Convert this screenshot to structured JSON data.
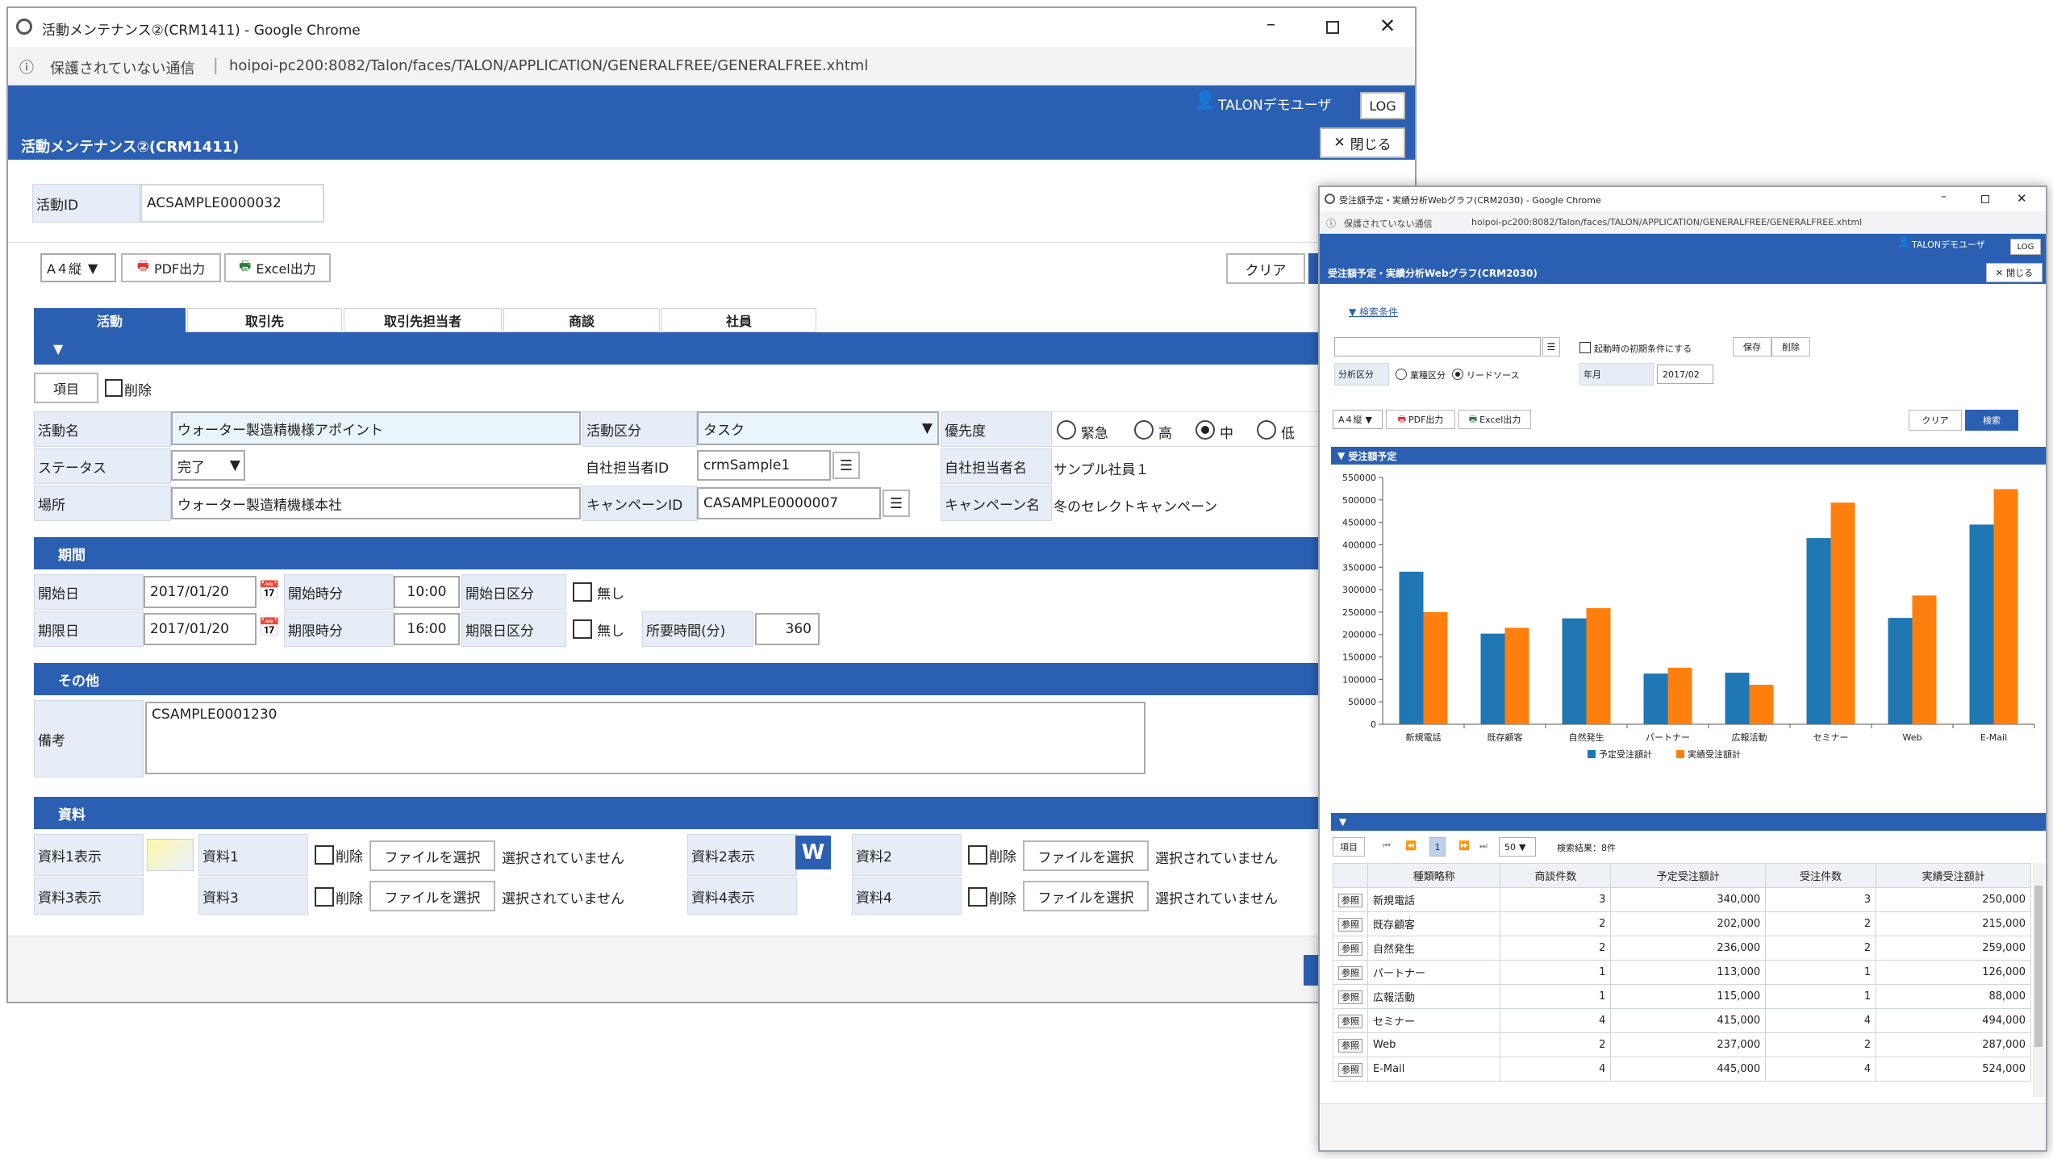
{
  "win1": {
    "title": "活動メンテナンス②(CRM1411) - Google Chrome",
    "not_secure": "保護されていない通信",
    "url": "hoipoi-pc200:8082/Talon/faces/TALON/APPLICATION/GENERALFREE/GENERALFREE.xhtml",
    "user": "TALONデモユーザ",
    "log": "LOG",
    "close": "閉じる",
    "page_title": "活動メンテナンス②(CRM1411)",
    "id_label": "活動ID",
    "id_value": "ACSAMPLE0000032",
    "paper": "A４縦",
    "pdf": "PDF出力",
    "excel": "Excel出力",
    "clear": "クリア",
    "tabs": [
      "活動",
      "取引先",
      "取引先担当者",
      "商談",
      "社員"
    ],
    "item_btn": "項目",
    "delete": "削除",
    "activity_name_label": "活動名",
    "activity_name": "ウォーター製造精機様アポイント",
    "activity_type_label": "活動区分",
    "activity_type": "タスク",
    "priority_label": "優先度",
    "priority_options": [
      "緊急",
      "高",
      "中",
      "低"
    ],
    "status_label": "ステータス",
    "status": "完了",
    "owner_id_label": "自社担当者ID",
    "owner_id": "crmSample1",
    "owner_name_label": "自社担当者名",
    "owner_name": "サンプル社員１",
    "place_label": "場所",
    "place": "ウォーター製造精機様本社",
    "campaign_id_label": "キャンペーンID",
    "campaign_id": "CASAMPLE0000007",
    "campaign_name_label": "キャンペーン名",
    "campaign_name": "冬のセレクトキャンペーン",
    "period_section": "期間",
    "start_date_label": "開始日",
    "start_date": "2017/01/20",
    "start_time_label": "開始時分",
    "start_time": "10:00",
    "start_kind_label": "開始日区分",
    "none": "無し",
    "end_date_label": "期限日",
    "end_date": "2017/01/20",
    "end_time_label": "期限時分",
    "end_time": "16:00",
    "end_kind_label": "期限日区分",
    "duration_label": "所要時間(分)",
    "duration": "360",
    "other_section": "その他",
    "note_label": "備考",
    "note": "CSAMPLE0001230",
    "docs_section": "資料",
    "doc1_show": "資料1表示",
    "doc1": "資料1",
    "doc2_show": "資料2表示",
    "doc2": "資料2",
    "doc3_show": "資料3表示",
    "doc3": "資料3",
    "doc4_show": "資料4表示",
    "doc4": "資料4",
    "choose_file": "ファイルを選択",
    "no_file": "選択されていません"
  },
  "win2": {
    "title": "受注額予定・実績分析Webグラフ(CRM2030) - Google Chrome",
    "not_secure": "保護されていない通信",
    "url": "hoipoi-pc200:8082/Talon/faces/TALON/APPLICATION/GENERALFREE/GENERALFREE.xhtml",
    "user": "TALONデモユーザ",
    "log": "LOG",
    "page_title": "受注額予定・実績分析Webグラフ(CRM2030)",
    "close": "閉じる",
    "search_cond": "検索条件",
    "init_cond": "起動時の初期条件にする",
    "save": "保存",
    "delete": "削除",
    "analysis_label": "分析区分",
    "opt1": "業種区分",
    "opt2": "リードソース",
    "ym_label": "年月",
    "ym": "2017/02",
    "paper": "A４縦",
    "pdf": "PDF出力",
    "excel": "Excel出力",
    "clear": "クリア",
    "search": "検索",
    "chart_section": "受注額予定",
    "item_btn": "項目",
    "page": "1",
    "page_size": "50",
    "result": "検索結果：8件",
    "ref": "参照",
    "columns": [
      "種類略称",
      "商談件数",
      "予定受注額計",
      "受注件数",
      "実績受注額計"
    ],
    "rows": [
      [
        "新規電話",
        "3",
        "340,000",
        "3",
        "250,000"
      ],
      [
        "既存顧客",
        "2",
        "202,000",
        "2",
        "215,000"
      ],
      [
        "自然発生",
        "2",
        "236,000",
        "2",
        "259,000"
      ],
      [
        "パートナー",
        "1",
        "113,000",
        "1",
        "126,000"
      ],
      [
        "広報活動",
        "1",
        "115,000",
        "1",
        "88,000"
      ],
      [
        "セミナー",
        "4",
        "415,000",
        "4",
        "494,000"
      ],
      [
        "Web",
        "2",
        "237,000",
        "2",
        "287,000"
      ],
      [
        "E-Mail",
        "4",
        "445,000",
        "4",
        "524,000"
      ]
    ]
  },
  "chart_data": {
    "type": "bar",
    "categories": [
      "新規電話",
      "既存顧客",
      "自然発生",
      "パートナー",
      "広報活動",
      "セミナー",
      "Web",
      "E-Mail"
    ],
    "series": [
      {
        "name": "予定受注額計",
        "values": [
          340000,
          202000,
          236000,
          113000,
          115000,
          415000,
          237000,
          445000
        ],
        "color": "#1f77b4"
      },
      {
        "name": "実績受注額計",
        "values": [
          250000,
          215000,
          259000,
          126000,
          88000,
          494000,
          287000,
          524000
        ],
        "color": "#ff7f0e"
      }
    ],
    "ylim": [
      0,
      550000
    ],
    "yticks": [
      "0",
      "50000",
      "100000",
      "150000",
      "200000",
      "250000",
      "300000",
      "350000",
      "400000",
      "450000",
      "500000",
      "550000"
    ],
    "legend": "bottom",
    "grid": false
  }
}
